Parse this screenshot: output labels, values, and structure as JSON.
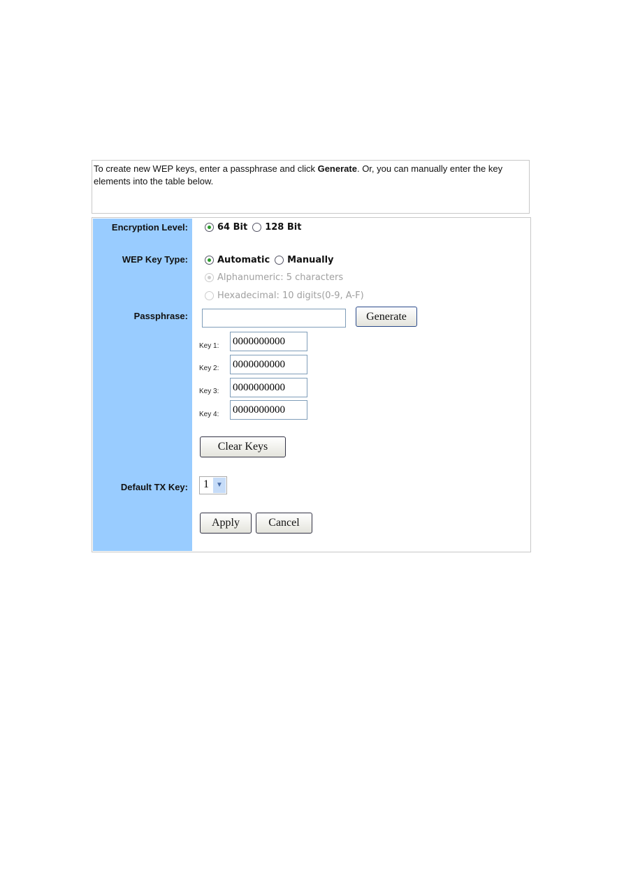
{
  "intro": {
    "text_before": "To create new WEP keys, enter a passphrase and click ",
    "bold": "Generate",
    "text_after": ". Or, you can manually enter the key elements into the table below."
  },
  "encryption": {
    "label": "Encryption Level:",
    "options": [
      "64 Bit",
      "128 Bit"
    ],
    "selected": "64 Bit"
  },
  "key_type": {
    "label": "WEP Key Type:",
    "options": [
      "Automatic",
      "Manually"
    ],
    "selected": "Automatic",
    "sub_options": [
      "Alphanumeric: 5 characters",
      "Hexadecimal: 10 digits(0-9, A-F)"
    ],
    "sub_selected": "Alphanumeric: 5 characters"
  },
  "passphrase": {
    "label": "Passphrase:",
    "value": "",
    "generate": "Generate"
  },
  "keys": [
    {
      "label": "Key 1:",
      "value": "0000000000"
    },
    {
      "label": "Key 2:",
      "value": "0000000000"
    },
    {
      "label": "Key 3:",
      "value": "0000000000"
    },
    {
      "label": "Key 4:",
      "value": "0000000000"
    }
  ],
  "clear_keys": "Clear Keys",
  "default_tx": {
    "label": "Default TX Key:",
    "value": "1"
  },
  "apply": "Apply",
  "cancel": "Cancel"
}
